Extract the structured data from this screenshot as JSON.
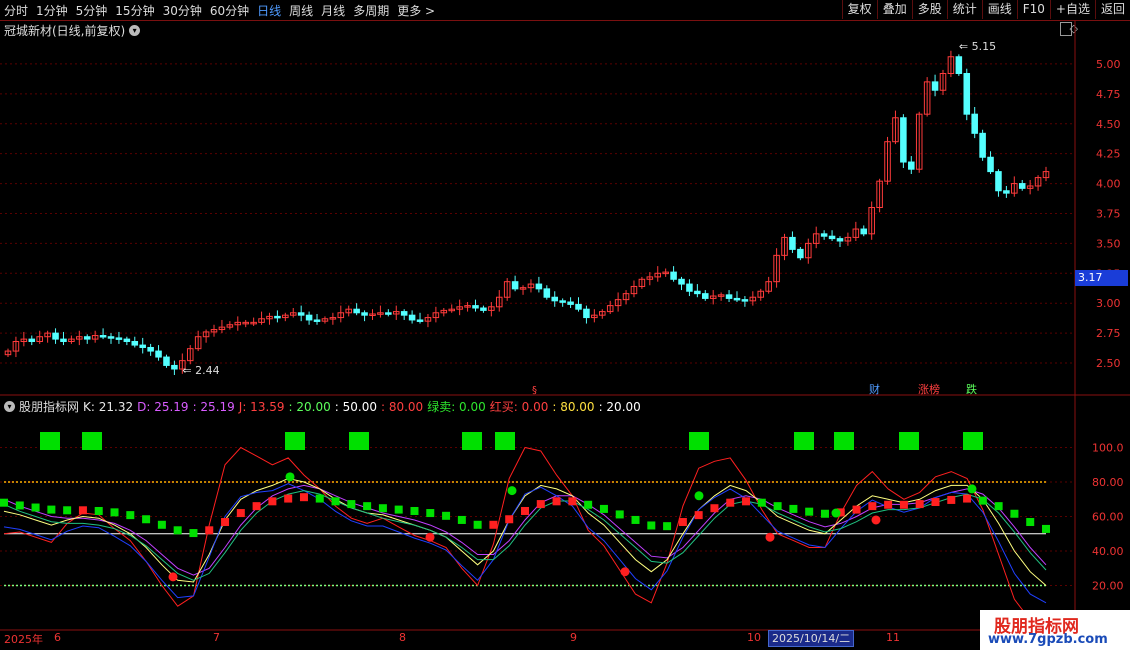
{
  "toolbar": {
    "periods": [
      "分时",
      "1分钟",
      "5分钟",
      "15分钟",
      "30分钟",
      "60分钟",
      "日线",
      "周线",
      "月线",
      "多周期",
      "更多 >"
    ],
    "active_period": "日线",
    "right_buttons": [
      "复权",
      "叠加",
      "多股",
      "统计",
      "画线",
      "F10",
      "+自选",
      "返回"
    ]
  },
  "stock": {
    "title": "冠城新材(日线,前复权)"
  },
  "price_axis": {
    "ticks": [
      "5.00",
      "4.75",
      "4.50",
      "4.25",
      "4.00",
      "3.75",
      "3.50",
      "3.25",
      "3.00",
      "2.75",
      "2.50"
    ]
  },
  "current_price": "3.17",
  "annotations": {
    "high": "5.15",
    "low": "2.44"
  },
  "event_tags": {
    "fin": "财",
    "rank": "涨榜",
    "fall": "跌"
  },
  "indicator": {
    "name": "股朋指标网",
    "k": "K: 21.32",
    "d": "D: 25.19",
    "d2": ": 25.19",
    "j": "J: 13.59",
    "l20": ": 20.00",
    "l50": ": 50.00",
    "l80": ": 80.00",
    "sell": "绿卖: 0.00",
    "buy": "红买: 0.00",
    "v80": ": 80.00",
    "v20": ": 20.00",
    "ticks": [
      "100.0",
      "80.00",
      "60.00",
      "40.00",
      "20.00"
    ]
  },
  "dates": {
    "year": "2025年",
    "m6": "6",
    "m7": "7",
    "m8": "8",
    "m9": "9",
    "m10": "10",
    "highlight": "2025/10/14/二",
    "m11": "11"
  },
  "watermark": {
    "title": "股朋指标网",
    "url": "www.7gpzb.com"
  },
  "colors": {
    "up": "#ff3b3b",
    "down": "#54ffff",
    "accent": "#4f9bff",
    "buy_signal": "#00e000"
  },
  "chart_data": [
    {
      "type": "candlestick",
      "title": "冠城新材(日线,前复权)",
      "ylim": [
        2.4,
        5.2
      ],
      "closes": [
        2.6,
        2.68,
        2.7,
        2.68,
        2.72,
        2.75,
        2.7,
        2.68,
        2.7,
        2.72,
        2.7,
        2.73,
        2.72,
        2.71,
        2.7,
        2.68,
        2.65,
        2.63,
        2.6,
        2.55,
        2.48,
        2.45,
        2.52,
        2.62,
        2.72,
        2.76,
        2.78,
        2.8,
        2.82,
        2.84,
        2.84,
        2.84,
        2.87,
        2.89,
        2.88,
        2.9,
        2.92,
        2.9,
        2.86,
        2.85,
        2.87,
        2.88,
        2.92,
        2.95,
        2.92,
        2.9,
        2.91,
        2.92,
        2.91,
        2.93,
        2.9,
        2.86,
        2.85,
        2.88,
        2.92,
        2.94,
        2.95,
        2.97,
        2.98,
        2.96,
        2.94,
        2.97,
        3.05,
        3.18,
        3.12,
        3.13,
        3.16,
        3.12,
        3.05,
        3.02,
        3.01,
        2.99,
        2.95,
        2.88,
        2.9,
        2.93,
        2.98,
        3.03,
        3.08,
        3.14,
        3.2,
        3.22,
        3.25,
        3.26,
        3.2,
        3.16,
        3.1,
        3.08,
        3.04,
        3.06,
        3.07,
        3.04,
        3.03,
        3.02,
        3.05,
        3.1,
        3.18,
        3.4,
        3.55,
        3.45,
        3.38,
        3.5,
        3.58,
        3.56,
        3.54,
        3.52,
        3.55,
        3.62,
        3.58,
        3.8,
        4.02,
        4.35,
        4.55,
        4.18,
        4.12,
        4.58,
        4.85,
        4.78,
        4.92,
        5.06,
        4.92,
        4.58,
        4.42,
        4.22,
        4.1,
        3.94,
        3.92,
        4.0,
        3.96,
        3.98,
        4.05,
        4.1
      ]
    },
    {
      "type": "line",
      "title": "股朋指标网",
      "ylim": [
        0,
        120
      ],
      "series": [
        {
          "name": "K",
          "values": [
            63,
            61,
            58,
            55,
            58,
            60,
            59,
            55,
            50,
            42,
            32,
            23,
            22,
            38,
            58,
            70,
            75,
            78,
            82,
            80,
            76,
            70,
            65,
            62,
            61,
            58,
            55,
            52,
            48,
            40,
            32,
            40,
            58,
            72,
            78,
            76,
            72,
            62,
            55,
            45,
            35,
            28,
            35,
            50,
            64,
            72,
            78,
            75,
            68,
            60,
            56,
            52,
            50,
            58,
            66,
            72,
            70,
            68,
            70,
            75,
            78,
            78,
            70,
            56,
            40,
            28,
            20
          ]
        },
        {
          "name": "D",
          "values": [
            70,
            66,
            63,
            60,
            59,
            59,
            58,
            56,
            52,
            46,
            38,
            30,
            26,
            30,
            42,
            55,
            65,
            72,
            76,
            78,
            76,
            72,
            68,
            65,
            62,
            60,
            58,
            55,
            51,
            45,
            38,
            38,
            46,
            58,
            68,
            72,
            72,
            67,
            61,
            53,
            45,
            37,
            36,
            42,
            52,
            62,
            70,
            72,
            70,
            65,
            61,
            57,
            54,
            56,
            60,
            65,
            67,
            67,
            68,
            71,
            74,
            76,
            73,
            65,
            54,
            42,
            32
          ]
        },
        {
          "name": "J",
          "values": [
            50,
            51,
            48,
            45,
            56,
            62,
            61,
            53,
            46,
            34,
            20,
            8,
            14,
            55,
            90,
            100,
            95,
            90,
            94,
            84,
            76,
            66,
            59,
            56,
            59,
            54,
            49,
            46,
            42,
            30,
            20,
            44,
            82,
            100,
            98,
            84,
            72,
            52,
            43,
            29,
            15,
            10,
            33,
            66,
            88,
            92,
            94,
            81,
            64,
            50,
            46,
            42,
            42,
            62,
            78,
            86,
            76,
            70,
            74,
            83,
            86,
            82,
            64,
            38,
            12,
            0,
            0
          ]
        }
      ],
      "reference_lines": [
        20,
        50,
        80
      ]
    }
  ]
}
